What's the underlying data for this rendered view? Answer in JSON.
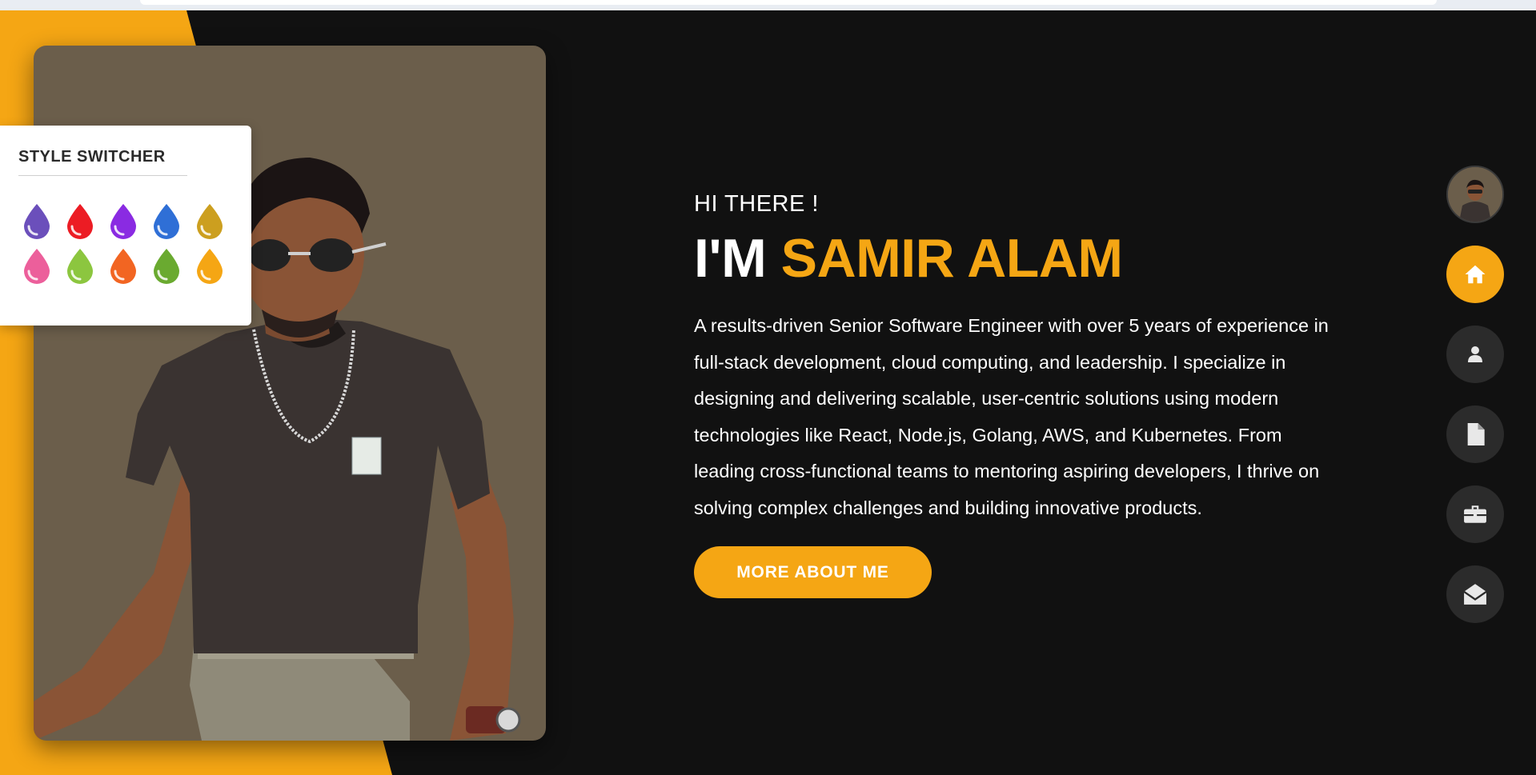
{
  "theme": {
    "accent": "#f5a614",
    "background": "#111111",
    "photo_bg": "#6b5e4b"
  },
  "style_switcher": {
    "title": "STYLE SWITCHER",
    "close_icon": "close-icon",
    "colors": [
      "#6b4fbb",
      "#ec1c24",
      "#8a2be2",
      "#2f6fd6",
      "#cc9f1f",
      "#ec5f9b",
      "#8cc63f",
      "#f26522",
      "#6aaa30",
      "#f5a614"
    ]
  },
  "hero": {
    "greeting": "HI THERE !",
    "intro": "I'M",
    "name": "SAMIR ALAM",
    "bio": "A results-driven Senior Software Engineer with over 5 years of experience in full-stack development, cloud computing, and leadership. I specialize in designing and delivering scalable, user-centric solutions using modern technologies like React, Node.js, Golang, AWS, and Kubernetes. From leading cross-functional teams to mentoring aspiring developers, I thrive on solving complex challenges and building innovative products.",
    "cta_label": "MORE ABOUT ME"
  },
  "nav": {
    "items": [
      {
        "icon": "avatar-icon",
        "active": false
      },
      {
        "icon": "home-icon",
        "active": true
      },
      {
        "icon": "user-icon",
        "active": false
      },
      {
        "icon": "document-icon",
        "active": false
      },
      {
        "icon": "briefcase-icon",
        "active": false
      },
      {
        "icon": "mail-open-icon",
        "active": false
      }
    ]
  }
}
